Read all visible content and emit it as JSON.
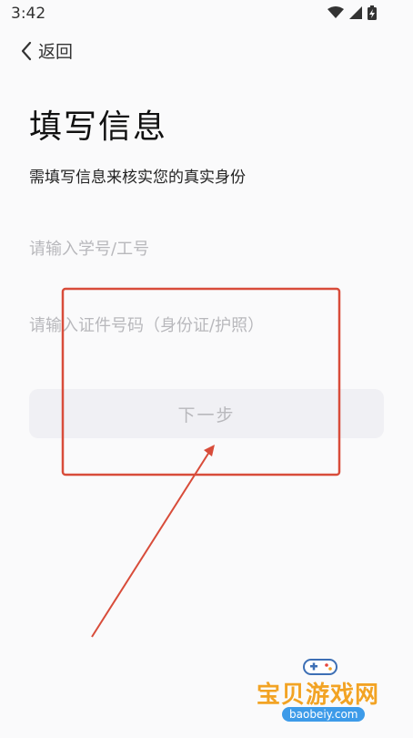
{
  "status_bar": {
    "time": "3:42"
  },
  "nav": {
    "back_label": "返回"
  },
  "page": {
    "title": "填写信息",
    "subtitle": "需填写信息来核实您的真实身份"
  },
  "form": {
    "id_placeholder": "请输入学号/工号",
    "cert_placeholder": "请输入证件号码（身份证/护照）",
    "next_label": "下一步"
  },
  "watermark": {
    "name": "宝贝游戏网",
    "url": "baobeiy.com"
  },
  "colors": {
    "annotation": "#d84c3a",
    "watermark": "#f2a324",
    "button_bg": "#f0f0f4"
  }
}
